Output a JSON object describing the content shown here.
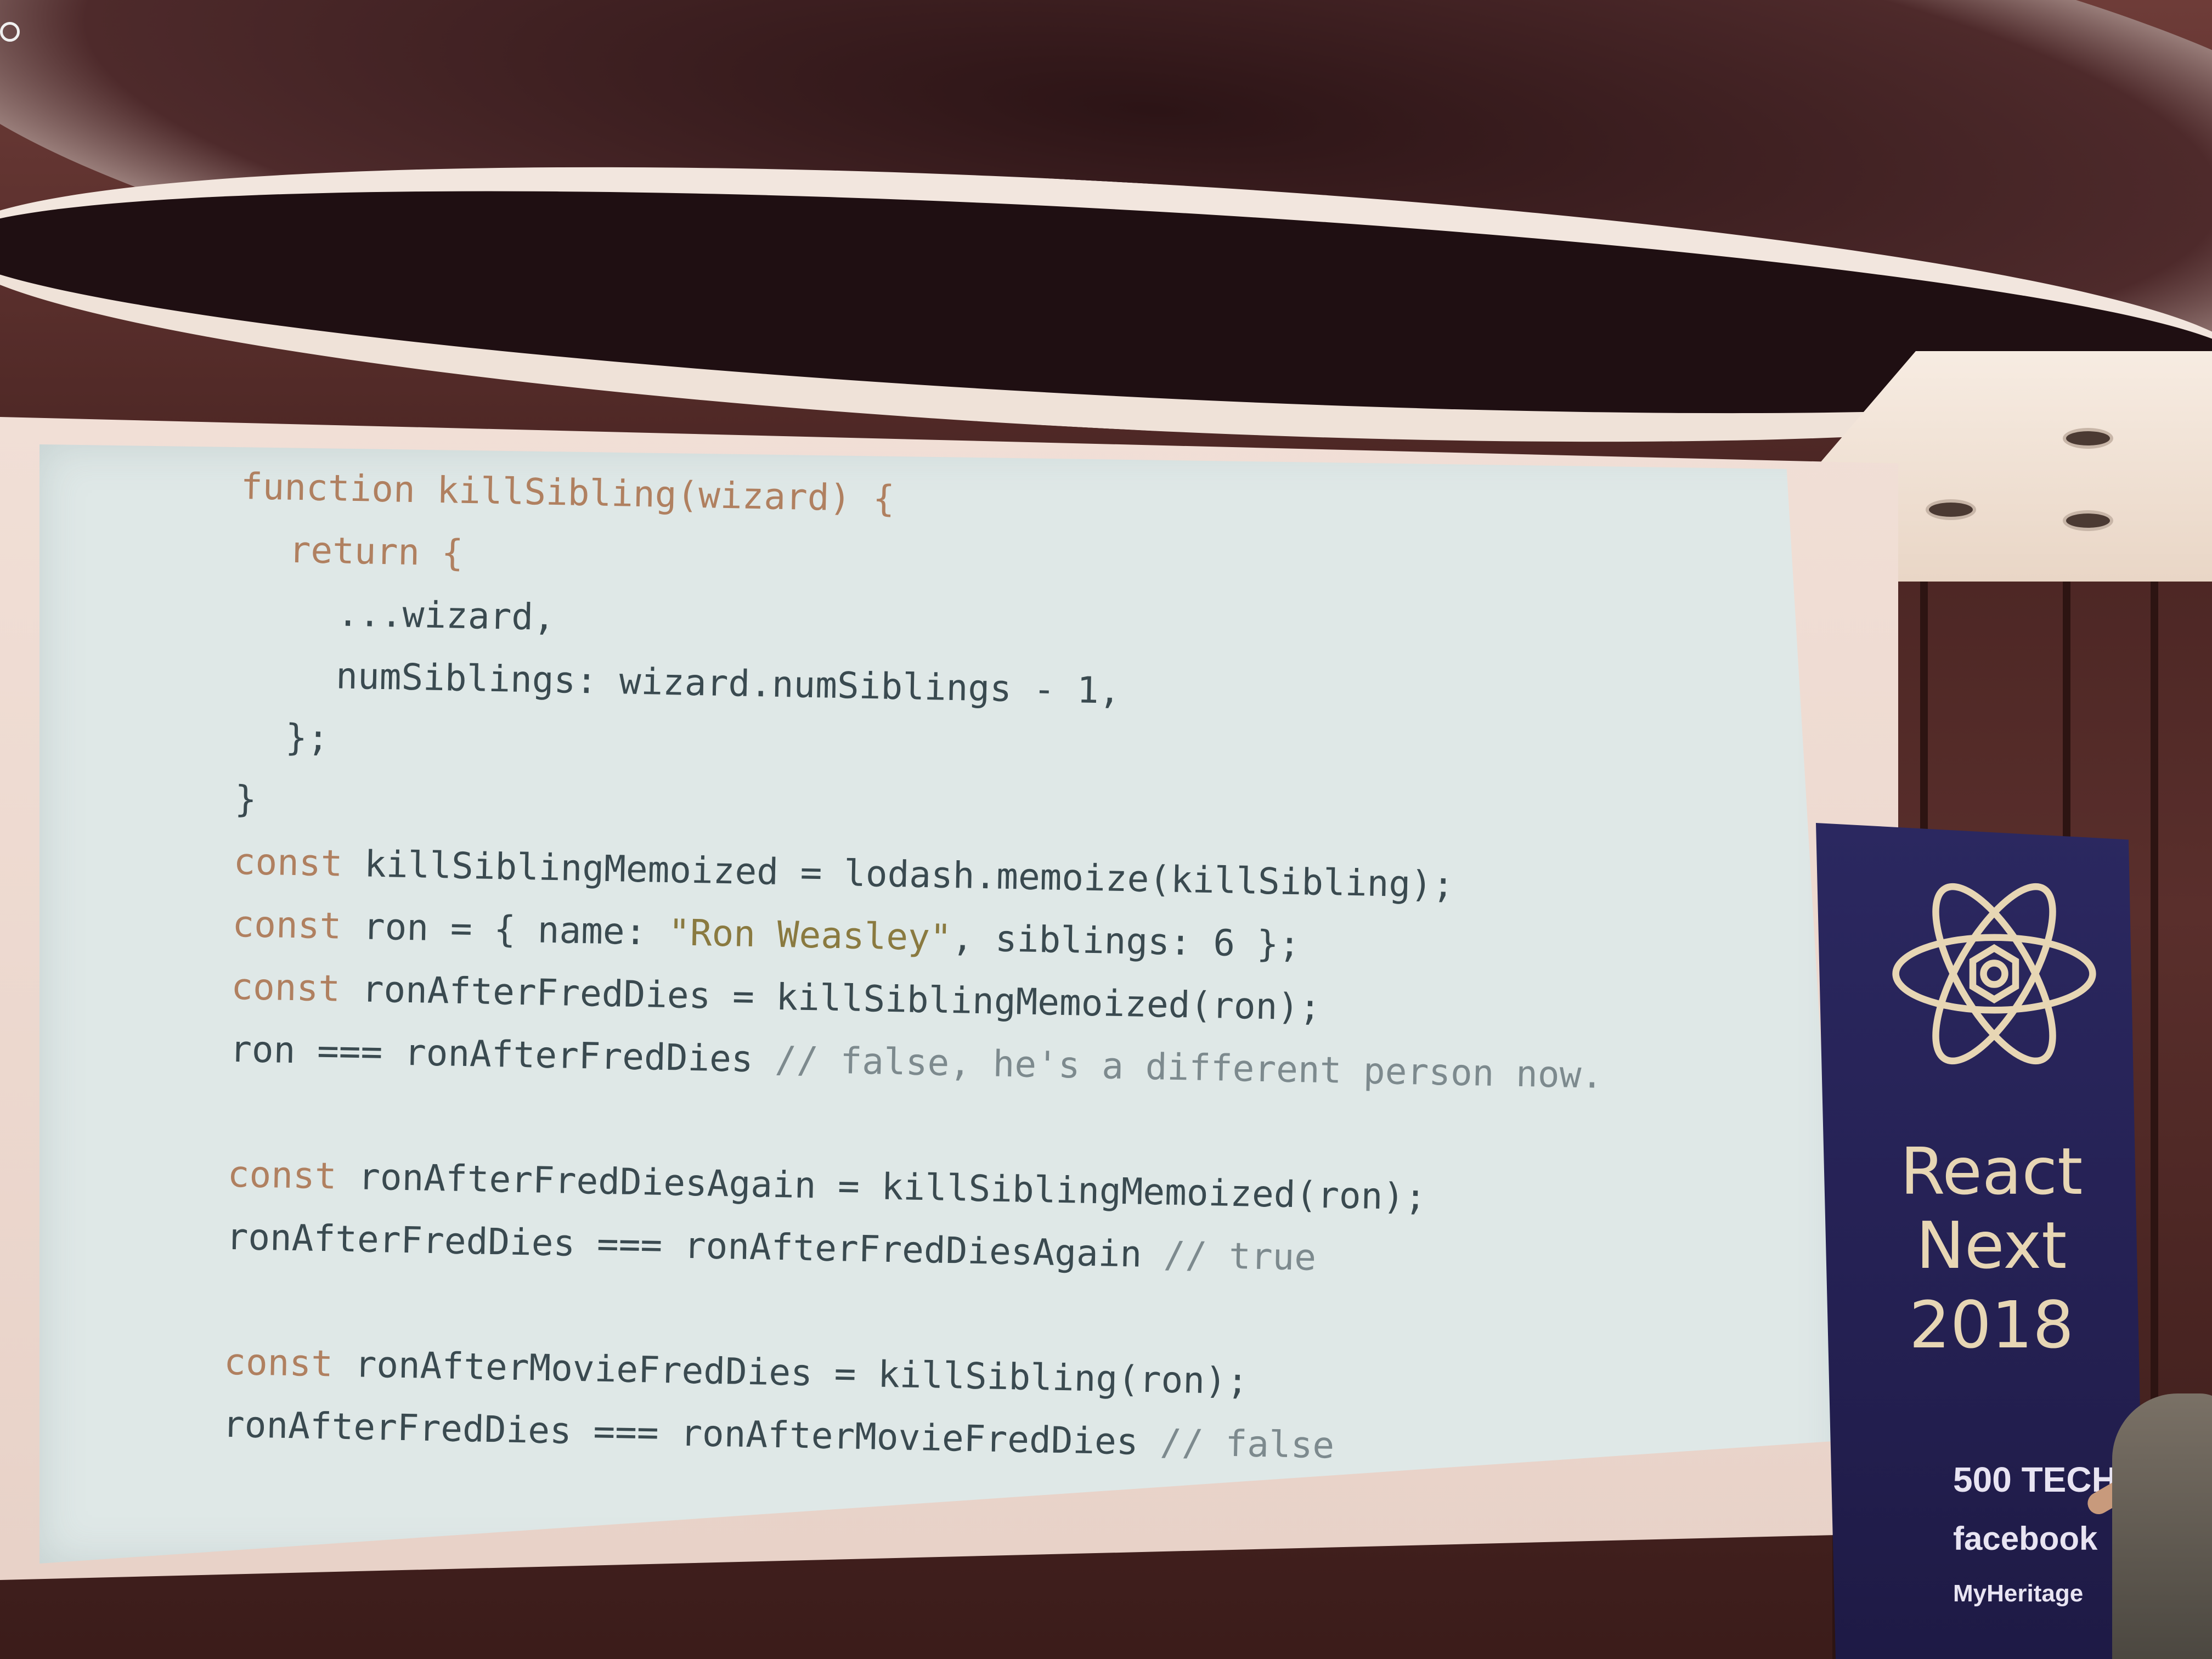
{
  "slide": {
    "lines": [
      {
        "indent": 0,
        "parts": [
          {
            "t": "function killSibling(wizard) {",
            "c": "kw"
          }
        ]
      },
      {
        "indent": 1,
        "parts": [
          {
            "t": "return {",
            "c": "kw"
          }
        ]
      },
      {
        "indent": 2,
        "parts": [
          {
            "t": "...wizard,",
            "c": ""
          }
        ]
      },
      {
        "indent": 2,
        "parts": [
          {
            "t": "numSiblings: wizard.numSiblings - 1,",
            "c": ""
          }
        ]
      },
      {
        "indent": 1,
        "parts": [
          {
            "t": "};",
            "c": ""
          }
        ]
      },
      {
        "indent": 0,
        "parts": [
          {
            "t": "}",
            "c": ""
          }
        ]
      },
      {
        "indent": 0,
        "parts": [
          {
            "t": "const",
            "c": "kw"
          },
          {
            "t": " killSiblingMemoized = lodash.memoize(killSibling);",
            "c": ""
          }
        ]
      },
      {
        "indent": 0,
        "parts": [
          {
            "t": "const",
            "c": "kw"
          },
          {
            "t": " ron = { name: ",
            "c": ""
          },
          {
            "t": "\"Ron Weasley\"",
            "c": "str"
          },
          {
            "t": ", siblings: 6 };",
            "c": ""
          }
        ]
      },
      {
        "indent": 0,
        "parts": [
          {
            "t": "const",
            "c": "kw"
          },
          {
            "t": " ronAfterFredDies = killSiblingMemoized(ron);",
            "c": ""
          }
        ]
      },
      {
        "indent": 0,
        "parts": [
          {
            "t": "ron === ronAfterFredDies ",
            "c": ""
          },
          {
            "t": "// false, he's a different person now.",
            "c": "cm"
          }
        ]
      },
      {
        "indent": 0,
        "parts": []
      },
      {
        "indent": 0,
        "parts": [
          {
            "t": "const",
            "c": "kw"
          },
          {
            "t": " ronAfterFredDiesAgain = killSiblingMemoized(ron);",
            "c": ""
          }
        ]
      },
      {
        "indent": 0,
        "parts": [
          {
            "t": "ronAfterFredDies === ronAfterFredDiesAgain ",
            "c": ""
          },
          {
            "t": "// true",
            "c": "cm"
          }
        ]
      },
      {
        "indent": 0,
        "parts": []
      },
      {
        "indent": 0,
        "parts": [
          {
            "t": "const",
            "c": "kw"
          },
          {
            "t": " ronAfterMovieFredDies = killSibling(ron);",
            "c": ""
          }
        ]
      },
      {
        "indent": 0,
        "parts": [
          {
            "t": "ronAfterFredDies === ronAfterMovieFredDies ",
            "c": ""
          },
          {
            "t": "// false",
            "c": "cm"
          }
        ]
      }
    ]
  },
  "banner": {
    "line1": "React",
    "line2": "Next",
    "line3": "2018",
    "sponsor1": "500 TECH",
    "sponsor2": "facebook",
    "sponsor3": "MyHeritage",
    "logo_icon": "react-atom-icon",
    "color": "#2b2860",
    "text_color": "#e7d6b4"
  }
}
